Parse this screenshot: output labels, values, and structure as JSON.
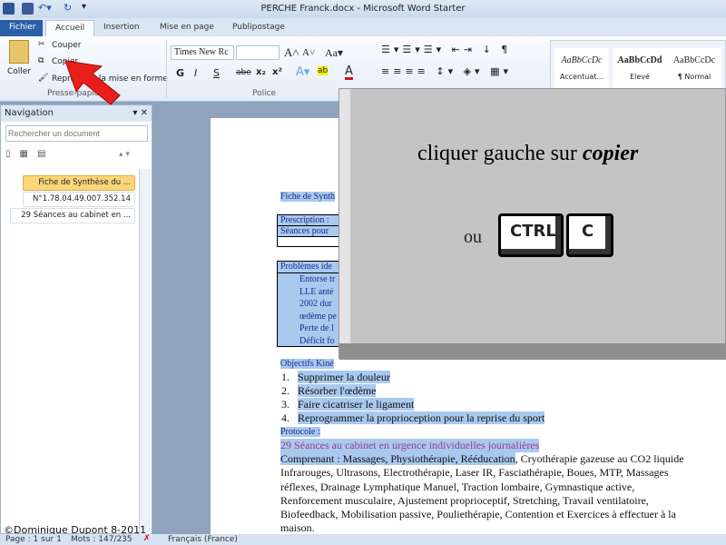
{
  "window": {
    "title": "PERCHE Franck.docx - Microsoft Word Starter"
  },
  "tabs": [
    {
      "label": "Fichier"
    },
    {
      "label": "Accueil"
    },
    {
      "label": "Insertion"
    },
    {
      "label": "Mise en page"
    },
    {
      "label": "Publipostage"
    }
  ],
  "ribbon": {
    "clipboard": {
      "paste": "Coller",
      "cut": "Couper",
      "copy": "Copier",
      "format_painter": "Reproduire la mise en forme",
      "group": "Presse-papiers"
    },
    "font": {
      "font_name": "Times New Rc",
      "font_size": "",
      "bold": "G",
      "italic": "I",
      "underline": "S",
      "strike": "abe",
      "sub": "x₂",
      "sup": "x²",
      "group": "Police"
    },
    "styles": [
      {
        "preview": "AaBbCcDc",
        "label": "Accentuat..."
      },
      {
        "preview": "AaBbCcDd",
        "label": "Elevé"
      },
      {
        "preview": "AaBbCcDc",
        "label": "¶ Normal"
      }
    ]
  },
  "navigation": {
    "title": "Navigation",
    "search_placeholder": "Rechercher un document",
    "items": [
      "Fiche de Synthèse du ...",
      "N°1.78.04.49.007.352.14",
      "29 Séances au cabinet en ..."
    ]
  },
  "document": {
    "heading": "Fiche de Synth",
    "table1": [
      "Prescription : ",
      "Séances pour"
    ],
    "problems_title": "Problèmes ide",
    "problems": [
      "Entorse tr",
      "LLE  anté",
      "2002  dur",
      "œdème pe",
      "Perte de l",
      "Déficit fo"
    ],
    "objectives_title": "Objectifs Kiné",
    "objectives": [
      "Supprimer  la douleur",
      "Résorber l'œdème",
      "Faire  cicatriser  le ligament",
      "Reprogrammer  la proprioception  pour la reprise  du sport"
    ],
    "protocol_title": "Protocole :",
    "protocol_line": "29 Séances au cabinet  en urgence  individuelles  journalières",
    "body_selected": "Comprenant  : Massages, Physiothérapie,  Rééducation",
    "body_lines": [
      ", Cryothérapie  gazeuse au CO2 liquide",
      "Infrarouges,  Ultrasons, Electrothérapie,  Laser IR, Fasciathérapie,  Boues, MTP, Massages",
      "réflexes,  Drainage  Lymphatique  Manuel, Traction lombaire,  Gymnastique  active,",
      "Renforcement  musculaire,  Ajustement  proprioceptif,  Stretching,  Travail  ventilatoire,",
      "Biofeedback,  Mobilisation  passive, Pouliethérapie,  Contention  et Exercices  à effectuer  à la",
      "maison."
    ]
  },
  "overlay": {
    "instruction_prefix": "cliquer gauche sur ",
    "instruction_emph": "copier",
    "or": "ou",
    "key1": "CTRL",
    "key2": "C"
  },
  "copyright": "©Dominique Dupont  8-2011",
  "status": {
    "page": "Page : 1 sur 1",
    "words": "Mots : 147/235",
    "language": "Français (France)"
  },
  "colors": {
    "arrow": "#e8201a",
    "selection": "#a9c9ef",
    "file_tab": "#2a5fa8"
  }
}
